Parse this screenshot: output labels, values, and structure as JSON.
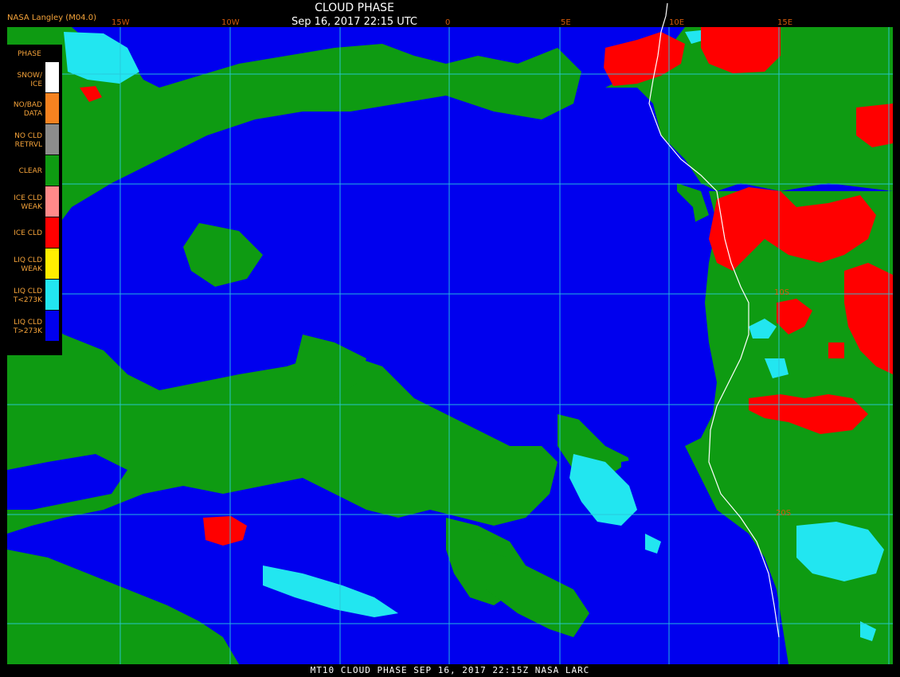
{
  "header": {
    "provider": "NASA Langley (M04.0)",
    "title": "CLOUD PHASE",
    "subtitle": "Sep 16, 2017 22:15 UTC"
  },
  "footer": {
    "caption": "MT10  CLOUD PHASE   SEP 16, 2017 22:15Z   NASA LARC"
  },
  "grid": {
    "longitude_labels": [
      "15W",
      "10W",
      "0",
      "5E",
      "10E",
      "15E"
    ],
    "latitude_labels": [
      "10S",
      "20S"
    ]
  },
  "legend": {
    "title": "PHASE",
    "items": [
      {
        "label": "SNOW/\nICE",
        "color": "#ffffff"
      },
      {
        "label": "NO/BAD\nDATA",
        "color": "#f58220"
      },
      {
        "label": "NO CLD\nRETRVL",
        "color": "#8c8c8c"
      },
      {
        "label": "CLEAR",
        "color": "#0e9b12"
      },
      {
        "label": "ICE CLD\nWEAK",
        "color": "#ff8a8a"
      },
      {
        "label": "ICE CLD",
        "color": "#ff0000"
      },
      {
        "label": "LIQ CLD\nWEAK",
        "color": "#ffee00"
      },
      {
        "label": "LIQ CLD\nT<273K",
        "color": "#22e6f0"
      },
      {
        "label": "LIQ CLD\nT>273K",
        "color": "#0000ee"
      }
    ]
  },
  "colors": {
    "ocean_liquid_warm": "#0000ee",
    "clear": "#0e9b12",
    "ice_cloud": "#ff0000",
    "liquid_cold": "#22e6f0",
    "gridline": "#29c9dc",
    "coastline": "#ffffff"
  }
}
